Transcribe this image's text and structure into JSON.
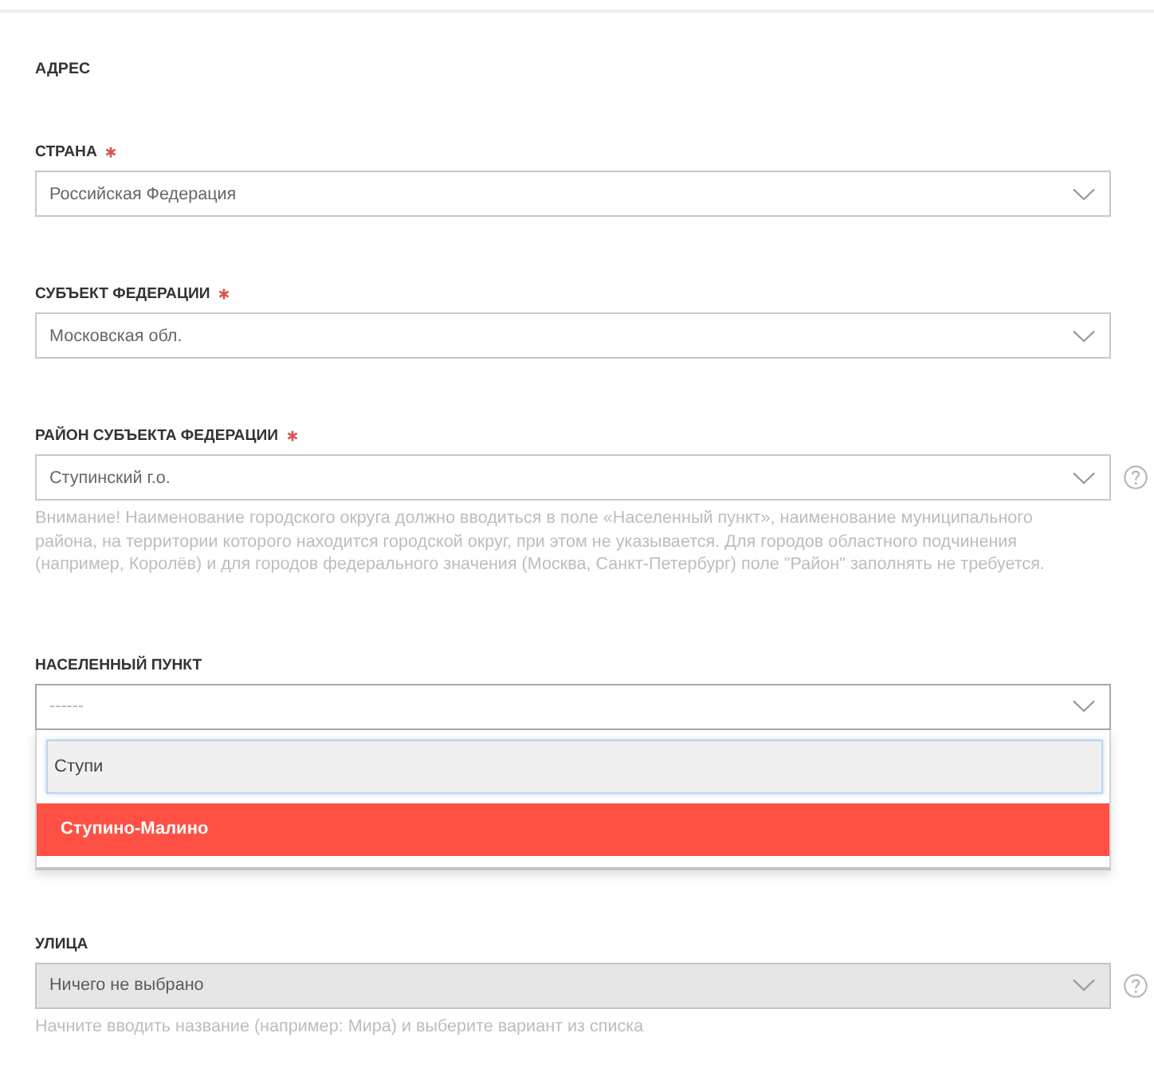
{
  "section_title": "АДРЕС",
  "fields": [
    {
      "label": "СТРАНА",
      "required": true,
      "value": "Российская Федерация",
      "disabled": false,
      "expanded": false,
      "help": false
    },
    {
      "label": "СУБЪЕКТ ФЕДЕРАЦИИ",
      "required": true,
      "value": "Московская обл.",
      "disabled": false,
      "expanded": false,
      "help": false
    },
    {
      "label": "РАЙОН СУБЪЕКТА ФЕДЕРАЦИИ",
      "required": true,
      "value": "Ступинский г.о.",
      "disabled": false,
      "expanded": false,
      "help": true,
      "hint": "Внимание! Наименование городского округа должно вводиться в поле «Населенный пункт», наименование муниципального района, на территории которого находится городской округ, при этом не указывается. Для городов областного подчинения (например, Королёв) и для городов федерального значения (Москва, Санкт-Петербург) поле \"Район\" заполнять не требуется."
    },
    {
      "label": "НАСЕЛЕННЫЙ ПУНКТ",
      "required": false,
      "placeholder": "------",
      "disabled": false,
      "expanded": true,
      "help": false,
      "dropdown": {
        "search_value": "Ступи",
        "options": [
          {
            "label": "Ступино-Малино",
            "selected": true
          }
        ]
      }
    },
    {
      "label": "УЛИЦА",
      "required": false,
      "placeholder": "Ничего не выбрано",
      "disabled": true,
      "expanded": false,
      "help": true,
      "hint": "Начните вводить название (например: Мира) и выберите вариант из списка"
    }
  ]
}
